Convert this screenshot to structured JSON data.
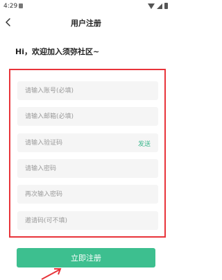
{
  "status_bar": {
    "time": "4:29"
  },
  "nav": {
    "title": "用户注册"
  },
  "greeting": "Hi，欢迎加入须弥社区~",
  "form": {
    "fields": [
      {
        "placeholder": "请输入账号(必填)"
      },
      {
        "placeholder": "请输入邮箱(必填)"
      },
      {
        "placeholder": "请输入验证码",
        "action": "发送"
      },
      {
        "placeholder": "请输入密码"
      },
      {
        "placeholder": "再次输入密码"
      },
      {
        "placeholder": "邀请码(可不填)"
      }
    ]
  },
  "register_button": "立即注册",
  "colors": {
    "accent": "#3dbf8f",
    "highlight_border": "#e8343a",
    "send_link": "#3ab78c"
  }
}
